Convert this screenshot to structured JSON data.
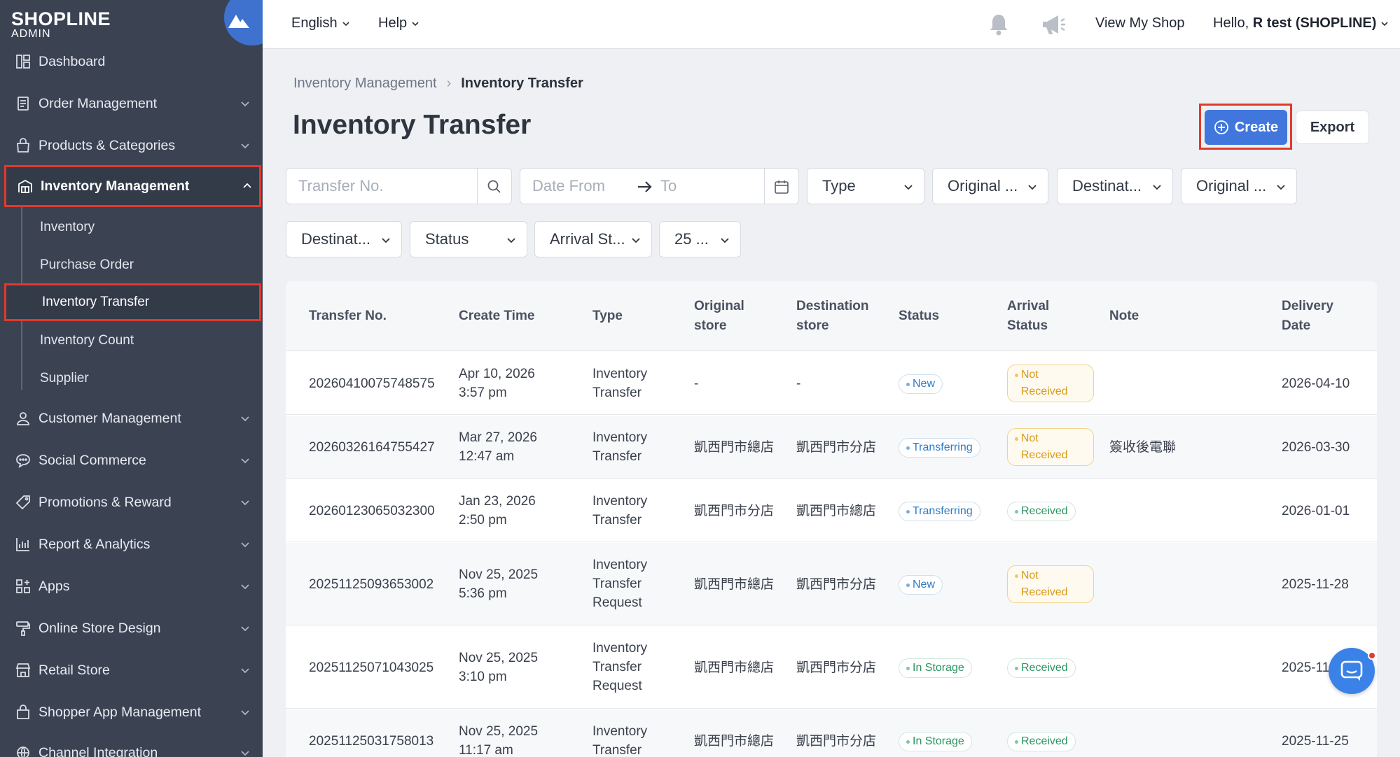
{
  "brand": {
    "name": "SHOPLINE",
    "sub": "ADMIN"
  },
  "topbar": {
    "language": "English",
    "help": "Help",
    "view_shop": "View My Shop",
    "greeting_prefix": "Hello, ",
    "user": "R test (SHOPLINE)"
  },
  "sidebar": {
    "items": [
      {
        "label": "Dashboard",
        "icon": "dashboard-icon"
      },
      {
        "label": "Order Management",
        "icon": "order-icon"
      },
      {
        "label": "Products & Categories",
        "icon": "bag-icon"
      },
      {
        "label": "Inventory Management",
        "icon": "warehouse-icon"
      },
      {
        "label": "Customer Management",
        "icon": "user-icon"
      },
      {
        "label": "Social Commerce",
        "icon": "chat-icon"
      },
      {
        "label": "Promotions & Reward",
        "icon": "tag-icon"
      },
      {
        "label": "Report & Analytics",
        "icon": "chart-icon"
      },
      {
        "label": "Apps",
        "icon": "apps-icon"
      },
      {
        "label": "Online Store Design",
        "icon": "paint-roller-icon"
      },
      {
        "label": "Retail Store",
        "icon": "store-icon"
      },
      {
        "label": "Shopper App Management",
        "icon": "shopping-bag-icon"
      },
      {
        "label": "Channel Integration",
        "icon": "channel-icon"
      }
    ],
    "sub_items": [
      {
        "label": "Inventory"
      },
      {
        "label": "Purchase Order"
      },
      {
        "label": "Inventory Transfer"
      },
      {
        "label": "Inventory Count"
      },
      {
        "label": "Supplier"
      }
    ]
  },
  "breadcrumb": {
    "parent": "Inventory Management",
    "current": "Inventory Transfer"
  },
  "page": {
    "title": "Inventory Transfer",
    "create": "Create",
    "export": "Export"
  },
  "filters": {
    "transfer_no_placeholder": "Transfer No.",
    "date_from_placeholder": "Date From",
    "date_to_placeholder": "To",
    "type": "Type",
    "original_1": "Original ...",
    "destination_1": "Destinat...",
    "original_2": "Original ...",
    "destination_2": "Destinat...",
    "status": "Status",
    "arrival": "Arrival St...",
    "per_page": "25 ..."
  },
  "table": {
    "headers": {
      "transfer_no": "Transfer No.",
      "create_time": "Create Time",
      "type": "Type",
      "original": "Original store",
      "destination": "Destination store",
      "status": "Status",
      "arrival": "Arrival Status",
      "note": "Note",
      "delivery": "Delivery Date"
    },
    "rows": [
      {
        "no": "20260410075748575",
        "date": "Apr 10, 2026",
        "time": "3:57 pm",
        "type": "Inventory Transfer",
        "orig": "-",
        "dest": "-",
        "status": "New",
        "arrival": "Not Received",
        "note": "",
        "delivery": "2026-04-10"
      },
      {
        "no": "20260326164755427",
        "date": "Mar 27, 2026",
        "time": "12:47 am",
        "type": "Inventory Transfer",
        "orig": "凱西門市總店",
        "dest": "凱西門市分店",
        "status": "Transferring",
        "arrival": "Not Received",
        "note": "簽收後電聯",
        "delivery": "2026-03-30"
      },
      {
        "no": "20260123065032300",
        "date": "Jan 23, 2026",
        "time": "2:50 pm",
        "type": "Inventory Transfer",
        "orig": "凱西門市分店",
        "dest": "凱西門市總店",
        "status": "Transferring",
        "arrival": "Received",
        "note": "",
        "delivery": "2026-01-01"
      },
      {
        "no": "20251125093653002",
        "date": "Nov 25, 2025",
        "time": "5:36 pm",
        "type": "Inventory Transfer Request",
        "orig": "凱西門市總店",
        "dest": "凱西門市分店",
        "status": "New",
        "arrival": "Not Received",
        "note": "",
        "delivery": "2025-11-28"
      },
      {
        "no": "20251125071043025",
        "date": "Nov 25, 2025",
        "time": "3:10 pm",
        "type": "Inventory Transfer Request",
        "orig": "凱西門市總店",
        "dest": "凱西門市分店",
        "status": "In Storage",
        "arrival": "Received",
        "note": "",
        "delivery": "2025-11"
      },
      {
        "no": "20251125031758013",
        "date": "Nov 25, 2025",
        "time": "11:17 am",
        "type": "Inventory Transfer",
        "orig": "凱西門市總店",
        "dest": "凱西門市分店",
        "status": "In Storage",
        "arrival": "Received",
        "note": "",
        "delivery": "2025-11-25"
      }
    ]
  },
  "colors": {
    "sidebar_bg": "#3b4353",
    "accent": "#4177dd",
    "highlight": "#e03a2e"
  }
}
